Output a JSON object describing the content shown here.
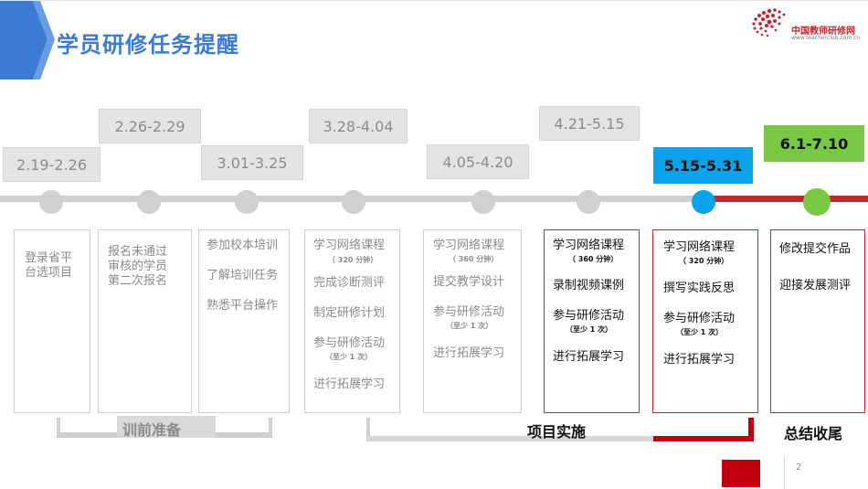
{
  "header": {
    "title": "学员研修任务提醒",
    "logo_name": "中国教师研修网",
    "logo_url": "www.teacherclub.com.cn"
  },
  "colors": {
    "accent_blue": "#3b7bd4",
    "active_blue": "#0aa2ea",
    "final_green": "#78c843",
    "highlight_red": "#c0282d",
    "inactive_grey": "#d0d0d0"
  },
  "timeline": {
    "dates": [
      "2.19-2.26",
      "2.26-2.29",
      "3.01-3.25",
      "3.28-4.04",
      "4.05-4.20",
      "4.21-5.15",
      "5.15-5.31",
      "6.1-7.10"
    ]
  },
  "stages": [
    {
      "items": [
        "登录省平",
        "台选项目"
      ]
    },
    {
      "items": [
        "报名未通过",
        "审核的学员",
        "第二次报名"
      ]
    },
    {
      "items": [
        "参加校本培训",
        "了解培训任务",
        "熟悉平台操作"
      ]
    },
    {
      "items": [
        "学习网络课程",
        "完成诊断测评",
        "制定研修计划",
        "参与研修活动",
        "进行拓展学习"
      ],
      "subs": [
        "（ 320 分钟）",
        "（至少  1 次）"
      ]
    },
    {
      "items": [
        "学习网络课程",
        "提交教学设计",
        "参与研修活动",
        "进行拓展学习"
      ],
      "subs": [
        "（ 360 分钟）",
        "（至少  1 次）"
      ]
    },
    {
      "items": [
        "学习网络课程",
        "录制视频课例",
        "参与研修活动",
        "进行拓展学习"
      ],
      "subs": [
        "（ 360 分钟）",
        "（至少  1 次）"
      ]
    },
    {
      "items": [
        "学习网络课程",
        "撰写实践反思",
        "参与研修活动",
        "进行拓展学习"
      ],
      "subs": [
        "（ 320 分钟）",
        "（至少  1 次）"
      ]
    },
    {
      "items": [
        "修改提交作品",
        "迎接发展测评"
      ]
    }
  ],
  "phases": {
    "prep": "训前准备",
    "implement": "项目实施",
    "summary": "总结收尾"
  },
  "page_number": "2"
}
